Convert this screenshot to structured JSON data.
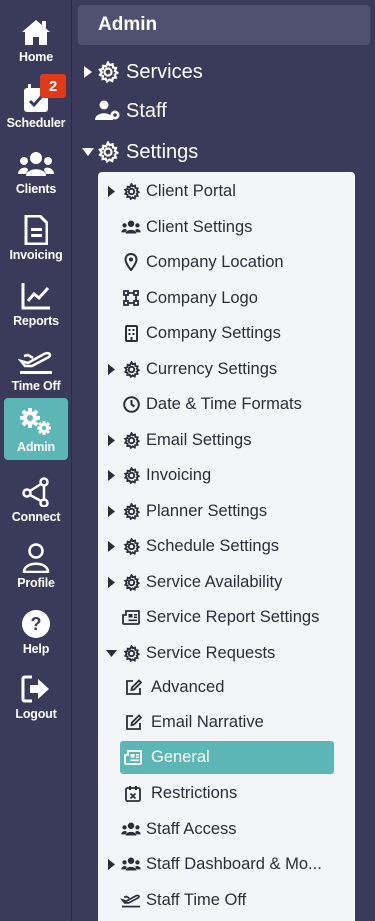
{
  "rail": {
    "home": "Home",
    "scheduler": "Scheduler",
    "scheduler_badge": "2",
    "clients": "Clients",
    "invoicing": "Invoicing",
    "reports": "Reports",
    "time_off": "Time Off",
    "admin": "Admin",
    "connect": "Connect",
    "profile": "Profile",
    "help": "Help",
    "logout": "Logout"
  },
  "header": {
    "title": "Admin"
  },
  "nav": {
    "services": "Services",
    "staff": "Staff",
    "settings": "Settings"
  },
  "settings_items": [
    "Client Portal",
    "Client Settings",
    "Company Location",
    "Company Logo",
    "Company Settings",
    "Currency Settings",
    "Date & Time Formats",
    "Email Settings",
    "Invoicing",
    "Planner Settings",
    "Schedule Settings",
    "Service Availability",
    "Service Report Settings",
    "Service Requests",
    "Advanced",
    "Email Narrative",
    "General",
    "Restrictions",
    "Staff Access",
    "Staff Dashboard & Mo...",
    "Staff Time Off"
  ],
  "colors": {
    "rail_bg": "#3a3b5a",
    "accent": "#5bb6b5",
    "badge": "#e03a1a",
    "panel_bg": "#f3f6f8"
  }
}
